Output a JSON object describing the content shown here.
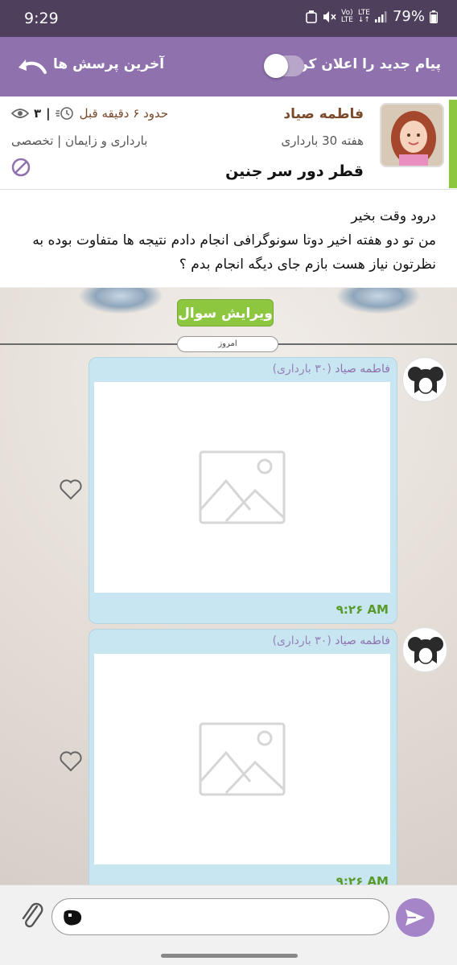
{
  "status_bar": {
    "time": "9:29",
    "battery": "79%",
    "signal_mini_1": "Vo)\nLTE",
    "signal_mini_2": "LTE\n↓↑"
  },
  "header": {
    "notify_label": "پیام جدید را اعلان کن",
    "recent_label": "آخرین پرسش ها",
    "toggle_on": false
  },
  "question": {
    "author": "فاطمه صیاد",
    "week": "هفته 30 بارداری",
    "title": "قطر دور سر جنین",
    "time_ago": "حدود ۶ دقیقه قبل",
    "views": "۳",
    "category": "بارداری و زایمان | تخصصی",
    "body": "درود وقت بخیر\nمن تو دو هفته اخیر دوتا سونوگرافی انجام دادم نتیجه ها متفاوت بوده به نظرتون نیاز هست بازم جای دیگه انجام بدم ؟"
  },
  "edit_button": "ویرایش سوال",
  "date_divider": "امروز",
  "messages": [
    {
      "author": "فاطمه صیاد",
      "meta": "(۳۰ بارداری)",
      "time": "۹:۲۶ AM"
    },
    {
      "author": "فاطمه صیاد",
      "meta": "(۳۰ بارداری)",
      "time": "۹:۲۶ AM"
    }
  ],
  "input": {
    "placeholder": "",
    "value": ""
  },
  "colors": {
    "header": "#8e71ad",
    "status_bar": "#4e3f5d",
    "accent_green": "#8dc63f",
    "bubble": "#c7e6f1",
    "send": "#a584c8"
  }
}
